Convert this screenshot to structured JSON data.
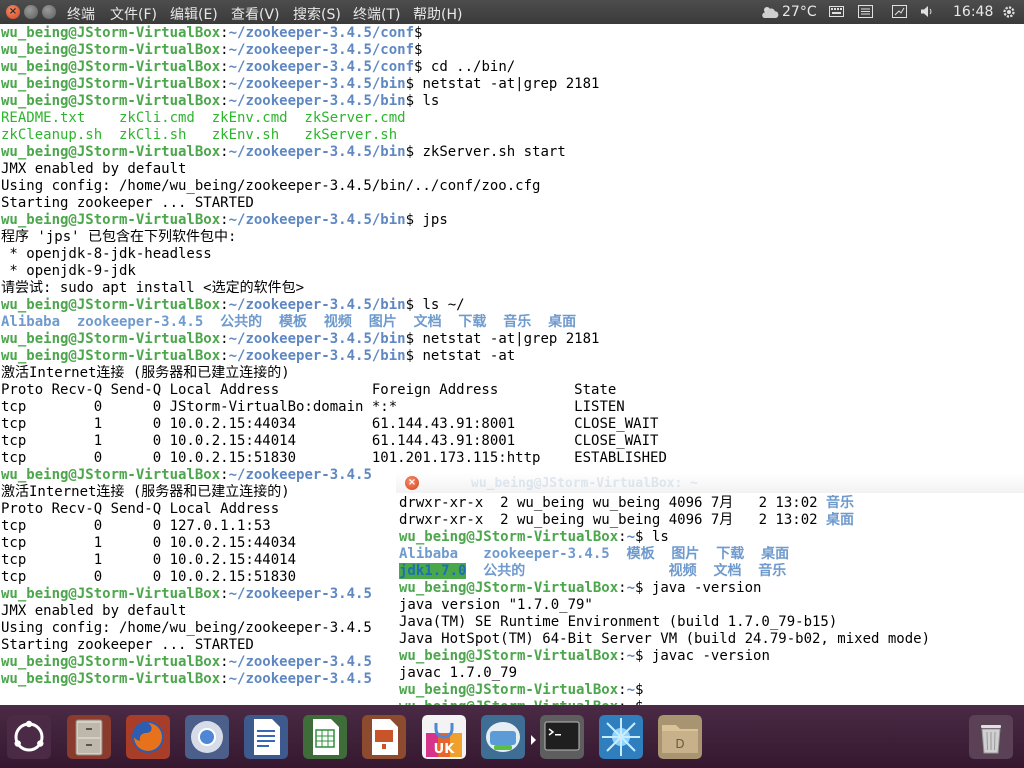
{
  "topbar": {
    "close_glyph": "×",
    "menu": [
      "终端",
      "文件(F)",
      "编辑(E)",
      "查看(V)",
      "搜索(S)",
      "终端(T)",
      "帮助(H)"
    ],
    "weather_temp": "27°C",
    "clock": "16:48"
  },
  "main_terminal": {
    "lines": [
      [
        {
          "t": "wu_being@JStorm-VirtualBox",
          "c": "g"
        },
        {
          "t": ":",
          "c": ""
        },
        {
          "t": "~/zookeeper-3.4.5/conf",
          "c": "b"
        },
        {
          "t": "$",
          "c": ""
        }
      ],
      [
        {
          "t": "wu_being@JStorm-VirtualBox",
          "c": "g"
        },
        {
          "t": ":",
          "c": ""
        },
        {
          "t": "~/zookeeper-3.4.5/conf",
          "c": "b"
        },
        {
          "t": "$",
          "c": ""
        }
      ],
      [
        {
          "t": "wu_being@JStorm-VirtualBox",
          "c": "g"
        },
        {
          "t": ":",
          "c": ""
        },
        {
          "t": "~/zookeeper-3.4.5/conf",
          "c": "b"
        },
        {
          "t": "$ cd ../bin/",
          "c": ""
        }
      ],
      [
        {
          "t": "wu_being@JStorm-VirtualBox",
          "c": "g"
        },
        {
          "t": ":",
          "c": ""
        },
        {
          "t": "~/zookeeper-3.4.5/bin",
          "c": "b"
        },
        {
          "t": "$ netstat -at|grep 2181",
          "c": ""
        }
      ],
      [
        {
          "t": "wu_being@JStorm-VirtualBox",
          "c": "g"
        },
        {
          "t": ":",
          "c": ""
        },
        {
          "t": "~/zookeeper-3.4.5/bin",
          "c": "b"
        },
        {
          "t": "$ ls",
          "c": ""
        }
      ],
      [
        {
          "t": "README.txt    zkCli.cmd  zkEnv.cmd  zkServer.cmd",
          "c": "gc"
        }
      ],
      [
        {
          "t": "zkCleanup.sh  zkCli.sh   zkEnv.sh   zkServer.sh",
          "c": "gc"
        }
      ],
      [
        {
          "t": "wu_being@JStorm-VirtualBox",
          "c": "g"
        },
        {
          "t": ":",
          "c": ""
        },
        {
          "t": "~/zookeeper-3.4.5/bin",
          "c": "b"
        },
        {
          "t": "$ zkServer.sh start",
          "c": ""
        }
      ],
      [
        {
          "t": "JMX enabled by default",
          "c": ""
        }
      ],
      [
        {
          "t": "Using config: /home/wu_being/zookeeper-3.4.5/bin/../conf/zoo.cfg",
          "c": ""
        }
      ],
      [
        {
          "t": "Starting zookeeper ... STARTED",
          "c": ""
        }
      ],
      [
        {
          "t": "wu_being@JStorm-VirtualBox",
          "c": "g"
        },
        {
          "t": ":",
          "c": ""
        },
        {
          "t": "~/zookeeper-3.4.5/bin",
          "c": "b"
        },
        {
          "t": "$ jps",
          "c": ""
        }
      ],
      [
        {
          "t": "程序 'jps' 已包含在下列软件包中:",
          "c": ""
        }
      ],
      [
        {
          "t": " * openjdk-8-jdk-headless",
          "c": ""
        }
      ],
      [
        {
          "t": " * openjdk-9-jdk",
          "c": ""
        }
      ],
      [
        {
          "t": "请尝试: sudo apt install <选定的软件包>",
          "c": ""
        }
      ],
      [
        {
          "t": "wu_being@JStorm-VirtualBox",
          "c": "g"
        },
        {
          "t": ":",
          "c": ""
        },
        {
          "t": "~/zookeeper-3.4.5/bin",
          "c": "b"
        },
        {
          "t": "$ ls ~/",
          "c": ""
        }
      ],
      [
        {
          "t": "Alibaba  zookeeper-3.4.5  公共的  模板  视频  图片  文档  下载  音乐  桌面",
          "c": "bl"
        }
      ],
      [
        {
          "t": "wu_being@JStorm-VirtualBox",
          "c": "g"
        },
        {
          "t": ":",
          "c": ""
        },
        {
          "t": "~/zookeeper-3.4.5/bin",
          "c": "b"
        },
        {
          "t": "$ netstat -at|grep 2181",
          "c": ""
        }
      ],
      [
        {
          "t": "wu_being@JStorm-VirtualBox",
          "c": "g"
        },
        {
          "t": ":",
          "c": ""
        },
        {
          "t": "~/zookeeper-3.4.5/bin",
          "c": "b"
        },
        {
          "t": "$ netstat -at",
          "c": ""
        }
      ],
      [
        {
          "t": "激活Internet连接 (服务器和已建立连接的)",
          "c": ""
        }
      ],
      [
        {
          "t": "Proto Recv-Q Send-Q Local Address           Foreign Address         State",
          "c": ""
        }
      ],
      [
        {
          "t": "tcp        0      0 JStorm-VirtualBo:domain *:*                     LISTEN",
          "c": ""
        }
      ],
      [
        {
          "t": "tcp        1      0 10.0.2.15:44034         61.144.43.91:8001       CLOSE_WAIT",
          "c": ""
        }
      ],
      [
        {
          "t": "tcp        1      0 10.0.2.15:44014         61.144.43.91:8001       CLOSE_WAIT",
          "c": ""
        }
      ],
      [
        {
          "t": "tcp        0      0 10.0.2.15:51830         101.201.173.115:http    ESTABLISHED",
          "c": ""
        }
      ],
      [
        {
          "t": "wu_being@JStorm-VirtualBox",
          "c": "g"
        },
        {
          "t": ":",
          "c": ""
        },
        {
          "t": "~/zookeeper-3.4.5",
          "c": "b"
        }
      ],
      [
        {
          "t": "激活Internet连接 (服务器和已建立连接的)",
          "c": ""
        }
      ],
      [
        {
          "t": "Proto Recv-Q Send-Q Local Address",
          "c": ""
        }
      ],
      [
        {
          "t": "tcp        0      0 127.0.1.1:53",
          "c": ""
        }
      ],
      [
        {
          "t": "tcp        1      0 10.0.2.15:44034",
          "c": ""
        }
      ],
      [
        {
          "t": "tcp        1      0 10.0.2.15:44014",
          "c": ""
        }
      ],
      [
        {
          "t": "tcp        0      0 10.0.2.15:51830",
          "c": ""
        }
      ],
      [
        {
          "t": "wu_being@JStorm-VirtualBox",
          "c": "g"
        },
        {
          "t": ":",
          "c": ""
        },
        {
          "t": "~/zookeeper-3.4.5",
          "c": "b"
        }
      ],
      [
        {
          "t": "JMX enabled by default",
          "c": ""
        }
      ],
      [
        {
          "t": "Using config: /home/wu_being/zookeeper-3.4.5",
          "c": ""
        }
      ],
      [
        {
          "t": "Starting zookeeper ... STARTED",
          "c": ""
        }
      ],
      [
        {
          "t": "wu_being@JStorm-VirtualBox",
          "c": "g"
        },
        {
          "t": ":",
          "c": ""
        },
        {
          "t": "~/zookeeper-3.4.5",
          "c": "b"
        }
      ],
      [
        {
          "t": "wu_being@JStorm-VirtualBox",
          "c": "g"
        },
        {
          "t": ":",
          "c": ""
        },
        {
          "t": "~/zookeeper-3.4.5",
          "c": "b"
        }
      ]
    ]
  },
  "second_terminal": {
    "close_glyph": "×",
    "ghost_title": "wu_being@JStorm-VirtualBox: ~",
    "lines": [
      [
        {
          "t": "drwxr-xr-x  2 wu_being wu_being 4096 7月   2 13:02 ",
          "c": ""
        },
        {
          "t": "音乐",
          "c": "bl"
        }
      ],
      [
        {
          "t": "drwxr-xr-x  2 wu_being wu_being 4096 7月   2 13:02 ",
          "c": ""
        },
        {
          "t": "桌面",
          "c": "bl"
        }
      ],
      [
        {
          "t": "wu_being@JStorm-VirtualBox",
          "c": "g"
        },
        {
          "t": ":",
          "c": ""
        },
        {
          "t": "~",
          "c": "b"
        },
        {
          "t": "$ ls",
          "c": ""
        }
      ],
      [
        {
          "t": "Alibaba   zookeeper-3.4.5  模板  图片  下载  桌面",
          "c": "bl"
        }
      ],
      [
        {
          "t": "jdk1.7.0",
          "c": "hl"
        },
        {
          "t": "  ",
          "c": ""
        },
        {
          "t": "公共的",
          "c": "bl"
        },
        {
          "t": "                 ",
          "c": ""
        },
        {
          "t": "视频  文档  音乐",
          "c": "bl"
        }
      ],
      [
        {
          "t": "wu_being@JStorm-VirtualBox",
          "c": "g"
        },
        {
          "t": ":",
          "c": ""
        },
        {
          "t": "~",
          "c": "b"
        },
        {
          "t": "$ java -version",
          "c": ""
        }
      ],
      [
        {
          "t": "java version \"1.7.0_79\"",
          "c": ""
        }
      ],
      [
        {
          "t": "Java(TM) SE Runtime Environment (build 1.7.0_79-b15)",
          "c": ""
        }
      ],
      [
        {
          "t": "Java HotSpot(TM) 64-Bit Server VM (build 24.79-b02, mixed mode)",
          "c": ""
        }
      ],
      [
        {
          "t": "wu_being@JStorm-VirtualBox",
          "c": "g"
        },
        {
          "t": ":",
          "c": ""
        },
        {
          "t": "~",
          "c": "b"
        },
        {
          "t": "$ javac -version",
          "c": ""
        }
      ],
      [
        {
          "t": "javac 1.7.0_79",
          "c": ""
        }
      ],
      [
        {
          "t": "wu_being@JStorm-VirtualBox",
          "c": "g"
        },
        {
          "t": ":",
          "c": ""
        },
        {
          "t": "~",
          "c": "b"
        },
        {
          "t": "$",
          "c": ""
        }
      ],
      [
        {
          "t": "wu_being@JStorm-VirtualBox",
          "c": "g"
        },
        {
          "t": ":",
          "c": ""
        },
        {
          "t": "~",
          "c": "b"
        },
        {
          "t": "$",
          "c": ""
        }
      ]
    ]
  },
  "launcher": {
    "apps": [
      {
        "name": "dash-icon",
        "color": "#3a3a3a"
      },
      {
        "name": "files-icon",
        "color": "#c9c2b5"
      },
      {
        "name": "firefox-icon",
        "color": "#e8711b"
      },
      {
        "name": "chromium-icon",
        "color": "#4f86d6"
      },
      {
        "name": "writer-icon",
        "color": "#3a66b8"
      },
      {
        "name": "calc-icon",
        "color": "#2f8f3a"
      },
      {
        "name": "impress-icon",
        "color": "#c9542a"
      },
      {
        "name": "software-center-icon",
        "color": "#e9632c"
      },
      {
        "name": "system-settings-icon",
        "color": "#5b9bd6"
      },
      {
        "name": "terminal-icon",
        "color": "#2b2b2b"
      },
      {
        "name": "starburst-app-icon",
        "color": "#39a3e4"
      },
      {
        "name": "folder-icon",
        "color": "#c7b08a"
      },
      {
        "name": "trash-icon",
        "color": "#d0d0d0"
      }
    ],
    "uk_label": "UK",
    "folder_label": "D"
  },
  "colors": {
    "prompt_user": "#4ca64c",
    "prompt_path": "#5f88c3",
    "launcher_bg": "#3f2139",
    "topbar_bg": "#434343"
  }
}
